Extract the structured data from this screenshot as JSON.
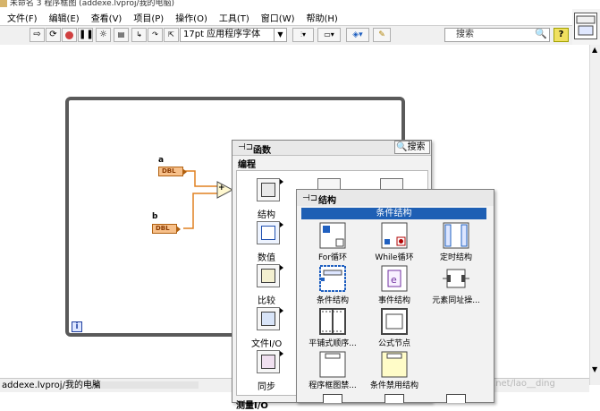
{
  "window": {
    "title": "未命名 3 程序框图 (addexe.lvproj/我的电脑)"
  },
  "menubar": {
    "items": [
      "文件(F)",
      "编辑(E)",
      "查看(V)",
      "项目(P)",
      "操作(O)",
      "工具(T)",
      "窗口(W)",
      "帮助(H)"
    ]
  },
  "toolbar": {
    "font": "17pt 应用程序字体",
    "search_placeholder": "搜索",
    "help_label": "?"
  },
  "diagram": {
    "terminal_a_label": "a",
    "terminal_b_label": "b",
    "dbl_label": "DBL",
    "add_symbol": "+",
    "iteration_label": "i"
  },
  "functions_palette": {
    "title": "函数",
    "search_label": "搜索",
    "category": "编程",
    "items": [
      {
        "label": "结构"
      },
      {
        "label": "数值"
      },
      {
        "label": "比较"
      },
      {
        "label": "文件I/O"
      },
      {
        "label": "同步"
      }
    ],
    "next_category": "测量I/O"
  },
  "structures_palette": {
    "title": "结构",
    "selected": "条件结构",
    "items": [
      {
        "label": "For循环"
      },
      {
        "label": "While循环"
      },
      {
        "label": "定时结构"
      },
      {
        "label": "条件结构"
      },
      {
        "label": "事件结构"
      },
      {
        "label": "元素同址操..."
      },
      {
        "label": "平铺式顺序..."
      },
      {
        "label": "公式节点"
      },
      {
        "label": "程序框图禁..."
      },
      {
        "label": "条件禁用结构"
      }
    ]
  },
  "statusbar": {
    "path": "addexe.lvproj/我的电脑",
    "scroll_left": "<"
  },
  "watermark": "https://blog.csdn.net/lao__ding",
  "colors": {
    "selection": "#1e5fb4",
    "dbl_terminal": "#f7c08a",
    "wire": "#e08020",
    "case_border": "#5a5a5a"
  }
}
